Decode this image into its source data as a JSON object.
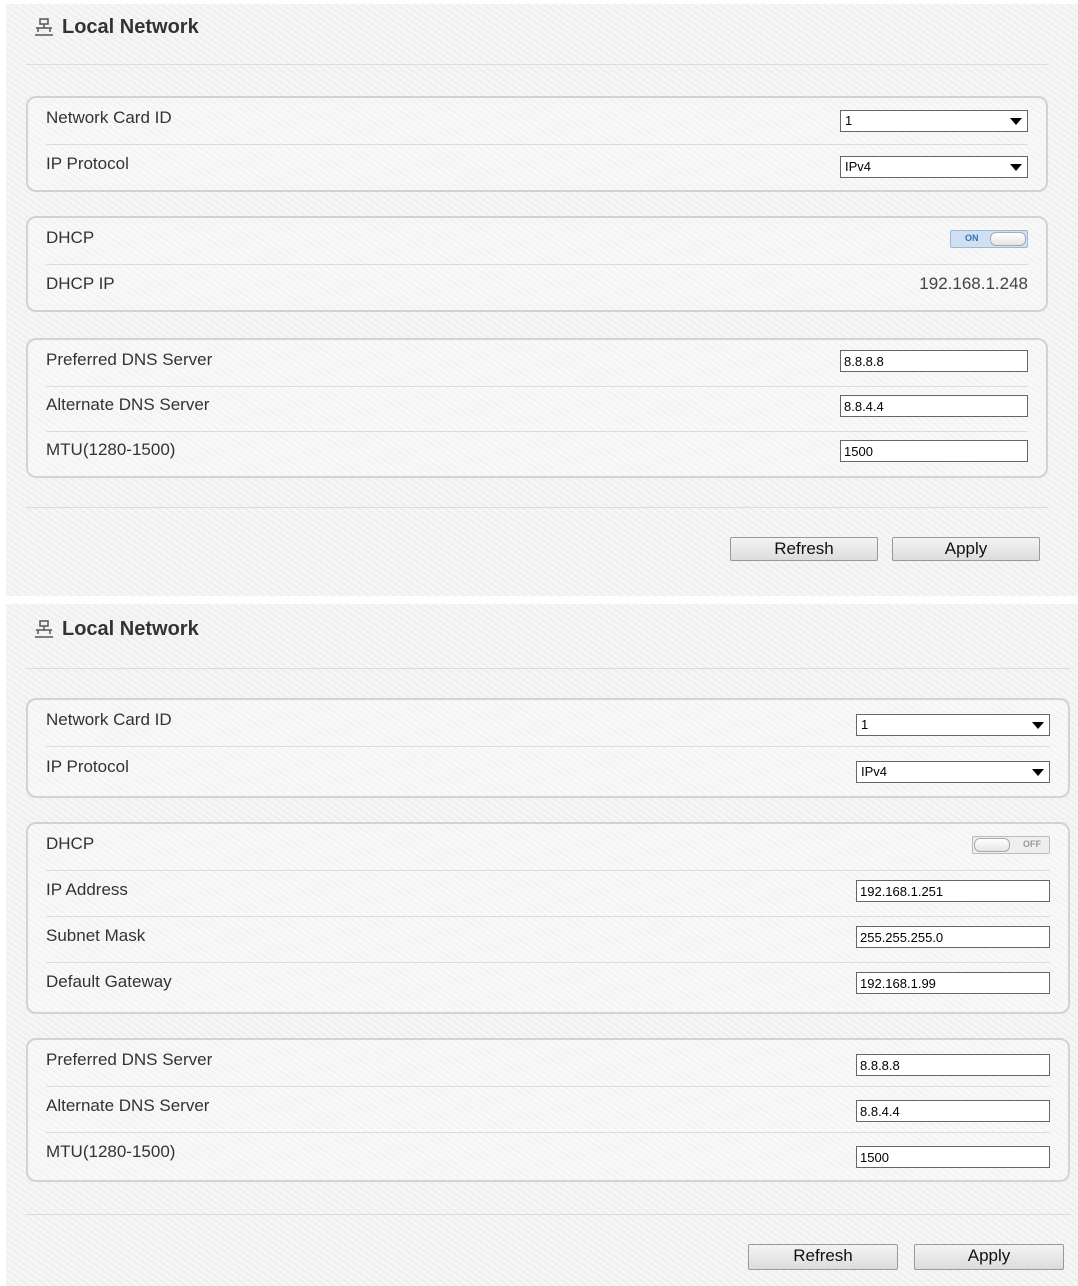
{
  "panel1": {
    "title": "Local Network",
    "network": {
      "card_id_label": "Network Card ID",
      "card_id_value": "1",
      "protocol_label": "IP Protocol",
      "protocol_value": "IPv4"
    },
    "dhcp": {
      "label": "DHCP",
      "toggle_state": "ON",
      "dhcp_ip_label": "DHCP IP",
      "dhcp_ip_value": "192.168.1.248"
    },
    "dns": {
      "preferred_label": "Preferred DNS Server",
      "preferred_value": "8.8.8.8",
      "alternate_label": "Alternate DNS Server",
      "alternate_value": "8.8.4.4",
      "mtu_label": "MTU(1280-1500)",
      "mtu_value": "1500"
    },
    "buttons": {
      "refresh": "Refresh",
      "apply": "Apply"
    }
  },
  "panel2": {
    "title": "Local Network",
    "network": {
      "card_id_label": "Network Card ID",
      "card_id_value": "1",
      "protocol_label": "IP Protocol",
      "protocol_value": "IPv4"
    },
    "dhcp": {
      "label": "DHCP",
      "toggle_state": "OFF",
      "ip_label": "IP Address",
      "ip_value": "192.168.1.251",
      "subnet_label": "Subnet Mask",
      "subnet_value": "255.255.255.0",
      "gateway_label": "Default Gateway",
      "gateway_value": "192.168.1.99"
    },
    "dns": {
      "preferred_label": "Preferred DNS Server",
      "preferred_value": "8.8.8.8",
      "alternate_label": "Alternate DNS Server",
      "alternate_value": "8.8.4.4",
      "mtu_label": "MTU(1280-1500)",
      "mtu_value": "1500"
    },
    "buttons": {
      "refresh": "Refresh",
      "apply": "Apply"
    }
  },
  "icons": {
    "title_icon": "network-icon"
  },
  "colors": {
    "toggle_on": "#cfe0f2",
    "toggle_on_text": "#3a6fb0",
    "panel_bg": "#f3f3f3"
  }
}
